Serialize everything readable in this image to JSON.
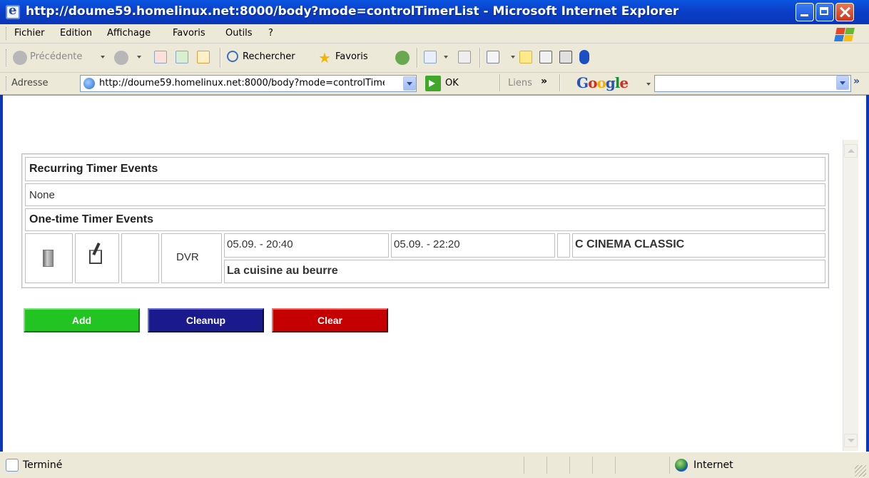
{
  "window": {
    "title": "http://doume59.homelinux.net:8000/body?mode=controlTimerList - Microsoft Internet Explorer",
    "minimize_icon": "minimize-icon",
    "maximize_icon": "maximize-icon",
    "close_icon": "close-icon"
  },
  "menubar": {
    "items": [
      "Fichier",
      "Edition",
      "Affichage",
      "Favoris",
      "Outils",
      "?"
    ]
  },
  "toolbar": {
    "back_label": "Précédente",
    "search_label": "Rechercher",
    "favorites_label": "Favoris"
  },
  "addressbar": {
    "label": "Adresse",
    "url": "http://doume59.homelinux.net:8000/body?mode=controlTimerList",
    "go_label": "OK",
    "links_label": "Liens",
    "chevron": "»",
    "google_label": "Google",
    "google_search_value": ""
  },
  "content": {
    "recurring_header": "Recurring Timer Events",
    "recurring_none": "None",
    "onetime_header": "One-time Timer Events",
    "timer": {
      "delete_icon": "trash-icon",
      "edit_icon": "edit-icon",
      "type": "DVR",
      "start": "05.09. - 20:40",
      "end": "05.09. - 22:20",
      "channel": "C CINEMA CLASSIC",
      "title": "La cuisine au beurre"
    }
  },
  "buttons": {
    "add": "Add",
    "cleanup": "Cleanup",
    "clear": "Clear"
  },
  "colors": {
    "add": "#22c422",
    "cleanup": "#1a1a8c",
    "clear": "#c40000",
    "titlebar": "#0a46d8"
  },
  "statusbar": {
    "text": "Terminé",
    "zone": "Internet"
  }
}
